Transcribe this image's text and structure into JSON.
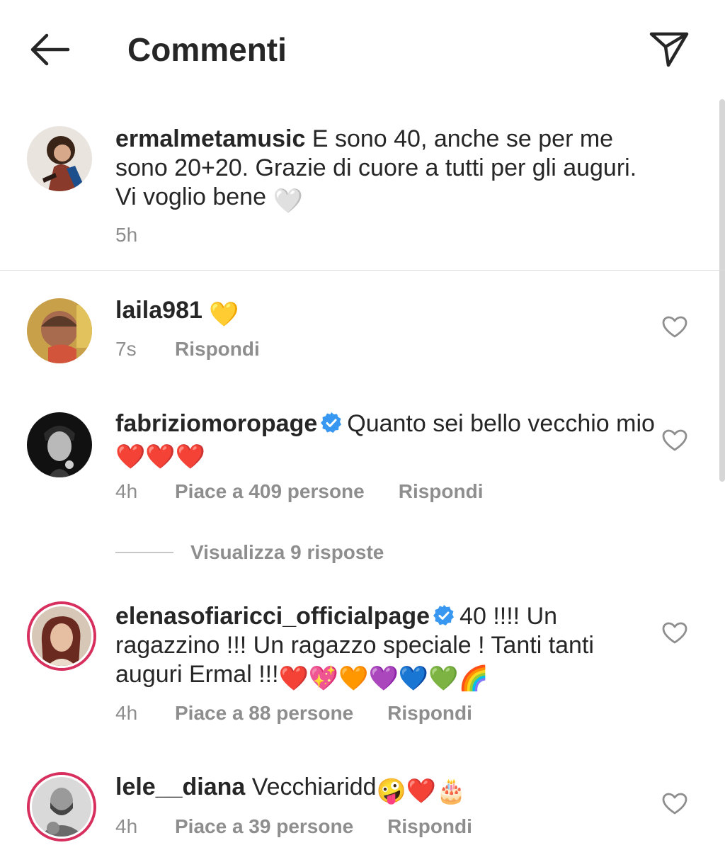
{
  "header": {
    "title": "Commenti",
    "back_icon": "arrow-left-icon",
    "share_icon": "paper-plane-icon"
  },
  "caption": {
    "username": "ermalmetamusic",
    "text": " E sono 40, anche se per me sono 20+20. Grazie di cuore a tutti per gli auguri. Vi voglio bene ",
    "emoji": "🤍",
    "time": "5h"
  },
  "comments": [
    {
      "username": "laila981",
      "text": " ",
      "emoji": "💛",
      "time": "7s",
      "likes": "",
      "reply": "Rispondi",
      "verified": false
    },
    {
      "username": "fabriziomoropage",
      "text": "Quanto sei bello vecchio mio ",
      "emoji": "❤️❤️❤️",
      "time": "4h",
      "likes": "Piace a 409 persone",
      "reply": "Rispondi",
      "verified": true,
      "view_replies": "Visualizza 9 risposte"
    },
    {
      "username": "elenasofiaricci_officialpage",
      "text": "40 !!!! Un ragazzino !!! Un ragazzo speciale ! Tanti tanti auguri Ermal !!!",
      "emoji": "❤️💖🧡💜💙💚🌈",
      "time": "4h",
      "likes": "Piace a 88 persone",
      "reply": "Rispondi",
      "verified": true
    },
    {
      "username": "lele__diana",
      "text": " Vecchiaridd",
      "emoji": "🤪❤️🎂",
      "time": "4h",
      "likes": "Piace a 39 persone",
      "reply": "Rispondi",
      "verified": false
    }
  ],
  "colors": {
    "text": "#262626",
    "secondary": "#8e8e8e",
    "verified": "#3897f0",
    "story_ring": "#d7305e"
  }
}
